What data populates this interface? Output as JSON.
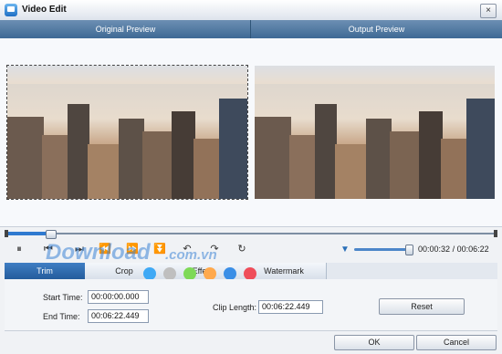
{
  "window": {
    "title": "Video Edit",
    "close_glyph": "×",
    "icon": "app-icon"
  },
  "preview": {
    "original_label": "Original Preview",
    "output_label": "Output Preview"
  },
  "playback": {
    "play_glyph": "⏸",
    "control_glyphs": [
      "⏮",
      "⏭",
      "⏪",
      "⏩",
      "⏬",
      "↶",
      "↷",
      "↻"
    ],
    "progress_fraction": 0.09,
    "volume_fraction": 0.88,
    "volume_icon": "speaker-icon",
    "current_time": "00:00:32",
    "time_separator": "/",
    "total_time": "00:06:22"
  },
  "overlay": {
    "brand": "Download",
    "domain": ".com.vn"
  },
  "tabs": [
    {
      "label": "Trim",
      "active": true
    },
    {
      "label": "Crop",
      "active": false
    },
    {
      "label": "Effect",
      "active": false
    },
    {
      "label": "Watermark",
      "active": false
    }
  ],
  "dots": {
    "colors": [
      "#3fa9f5",
      "#bfbfbf",
      "#7ed957",
      "#ffa94d",
      "#3a8ee6",
      "#ef4d5a"
    ]
  },
  "trim": {
    "start_label": "Start Time:",
    "start_value": "00:00:00.000",
    "end_label": "End Time:",
    "end_value": "00:06:22.449",
    "clip_label": "Clip Length:",
    "clip_value": "00:06:22.449",
    "reset_label": "Reset"
  },
  "footer": {
    "ok_label": "OK",
    "cancel_label": "Cancel"
  },
  "colors": {
    "header": "#3f6a95",
    "accent": "#2f7ad0",
    "tab_active": "#245c9c"
  }
}
